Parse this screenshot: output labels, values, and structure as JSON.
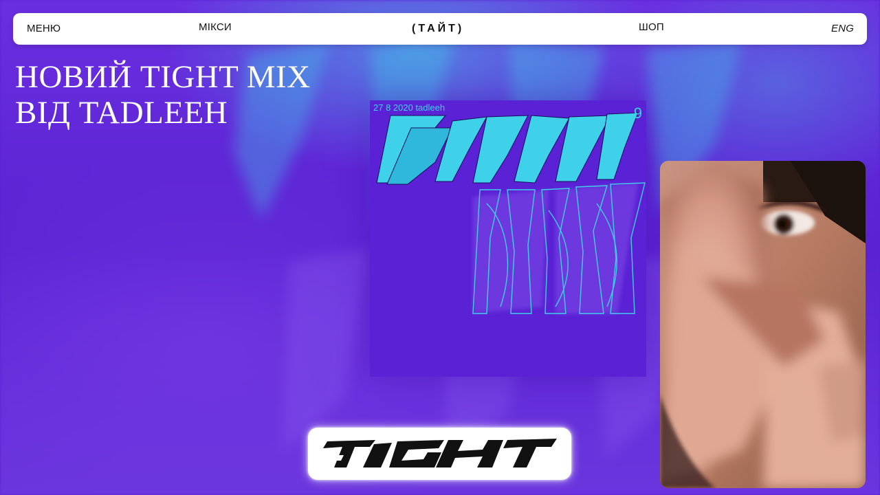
{
  "nav": {
    "menu": "МЕНЮ",
    "mixes": "МІКСИ",
    "logo": "(ТАЙТ)",
    "shop": "ШОП",
    "lang": "ENG"
  },
  "headline": {
    "line1": "НОВИЙ TIGHT MIX",
    "line2": "ВІД TADLEEH"
  },
  "cover": {
    "meta": "27 8 2020 tadleeh",
    "number": "9",
    "accent_color": "#3fd0ea"
  },
  "photo": {
    "subject": "blurred portrait with hand over face"
  },
  "logo_box": {
    "label": "TIGHT"
  },
  "colors": {
    "background": "#5b22d4",
    "accent": "#3fd0ea",
    "bar": "#ffffff"
  }
}
